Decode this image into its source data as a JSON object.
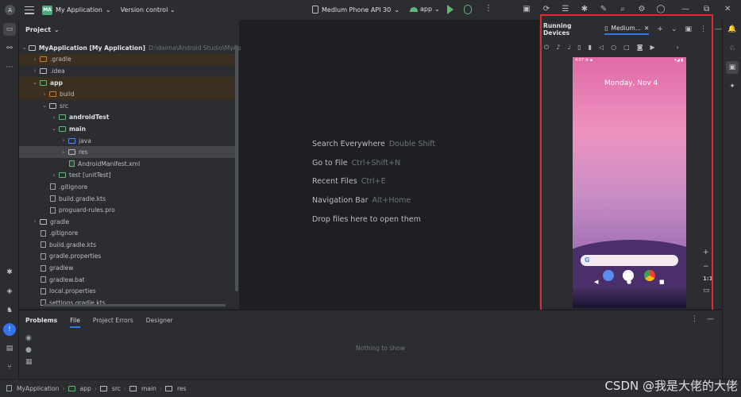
{
  "titlebar": {
    "project_badge": "MA",
    "project_name": "My Application",
    "version_control": "Version control",
    "device": "Medium Phone API 30",
    "run_config": "app"
  },
  "project_panel": {
    "title": "Project",
    "root_name": "MyApplication [My Application]",
    "root_path": "D:\\daima\\Android Studio\\MyApplic",
    "items": [
      {
        "label": ".gradle",
        "indent": 1,
        "kind": "folder-orange",
        "chev": "›"
      },
      {
        "label": ".idea",
        "indent": 1,
        "kind": "folder",
        "chev": "›"
      },
      {
        "label": "app",
        "indent": 1,
        "kind": "folder-green",
        "chev": "⌄",
        "bold": true
      },
      {
        "label": "build",
        "indent": 2,
        "kind": "folder-orange",
        "chev": "›"
      },
      {
        "label": "src",
        "indent": 2,
        "kind": "folder",
        "chev": "⌄"
      },
      {
        "label": "androidTest",
        "indent": 3,
        "kind": "folder-green",
        "chev": "›",
        "bold": true
      },
      {
        "label": "main",
        "indent": 3,
        "kind": "folder-green",
        "chev": "⌄",
        "bold": true
      },
      {
        "label": "java",
        "indent": 4,
        "kind": "folder-blue",
        "chev": "›"
      },
      {
        "label": "res",
        "indent": 4,
        "kind": "folder",
        "chev": "›"
      },
      {
        "label": "AndroidManifest.xml",
        "indent": 4,
        "kind": "file-green",
        "chev": ""
      },
      {
        "label": "test [unitTest]",
        "indent": 3,
        "kind": "folder-green",
        "chev": "›"
      },
      {
        "label": ".gitignore",
        "indent": 2,
        "kind": "file",
        "chev": ""
      },
      {
        "label": "build.gradle.kts",
        "indent": 2,
        "kind": "file",
        "chev": ""
      },
      {
        "label": "proguard-rules.pro",
        "indent": 2,
        "kind": "file",
        "chev": ""
      },
      {
        "label": "gradle",
        "indent": 1,
        "kind": "folder",
        "chev": "›"
      },
      {
        "label": ".gitignore",
        "indent": 1,
        "kind": "file",
        "chev": ""
      },
      {
        "label": "build.gradle.kts",
        "indent": 1,
        "kind": "file",
        "chev": ""
      },
      {
        "label": "gradle.properties",
        "indent": 1,
        "kind": "file",
        "chev": ""
      },
      {
        "label": "gradlew",
        "indent": 1,
        "kind": "file",
        "chev": ""
      },
      {
        "label": "gradlew.bat",
        "indent": 1,
        "kind": "file",
        "chev": ""
      },
      {
        "label": "local.properties",
        "indent": 1,
        "kind": "file",
        "chev": ""
      },
      {
        "label": "settings.gradle.kts",
        "indent": 1,
        "kind": "file",
        "chev": ""
      }
    ]
  },
  "editor": {
    "hints": [
      {
        "action": "Search Everywhere",
        "key": "Double Shift"
      },
      {
        "action": "Go to File",
        "key": "Ctrl+Shift+N"
      },
      {
        "action": "Recent Files",
        "key": "Ctrl+E"
      },
      {
        "action": "Navigation Bar",
        "key": "Alt+Home"
      },
      {
        "action": "Drop files here to open them",
        "key": ""
      }
    ]
  },
  "running_devices": {
    "title": "Running Devices",
    "tab": "Medium...",
    "clock_text": "Monday, Nov 4",
    "zoom_label": "1:1"
  },
  "bottom_panel": {
    "tabs": [
      "Problems",
      "File",
      "Project Errors",
      "Designer"
    ],
    "empty_text": "Nothing to show"
  },
  "breadcrumb": [
    "MyApplication",
    "app",
    "src",
    "main",
    "res"
  ],
  "watermark": "CSDN @我是大佬的大佬"
}
